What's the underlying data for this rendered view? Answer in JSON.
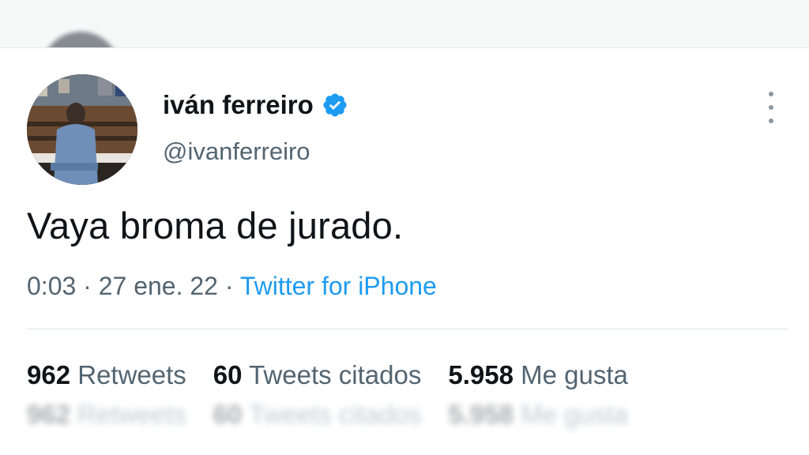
{
  "tweet": {
    "display_name": "iván ferreiro",
    "handle": "@ivanferreiro",
    "text": "Vaya broma de jurado.",
    "time": "0:03",
    "date": "27 ene. 22",
    "separator": "·",
    "source": "Twitter for iPhone"
  },
  "stats": {
    "retweets_count": "962",
    "retweets_label": "Retweets",
    "quotes_count": "60",
    "quotes_label": "Tweets citados",
    "likes_count": "5.958",
    "likes_label": "Me gusta"
  },
  "colors": {
    "accent": "#1d9bf0",
    "text_primary": "#0f1419",
    "text_secondary": "#536471"
  },
  "icons": {
    "verified": "verified-badge-icon",
    "more": "more-options-icon"
  }
}
